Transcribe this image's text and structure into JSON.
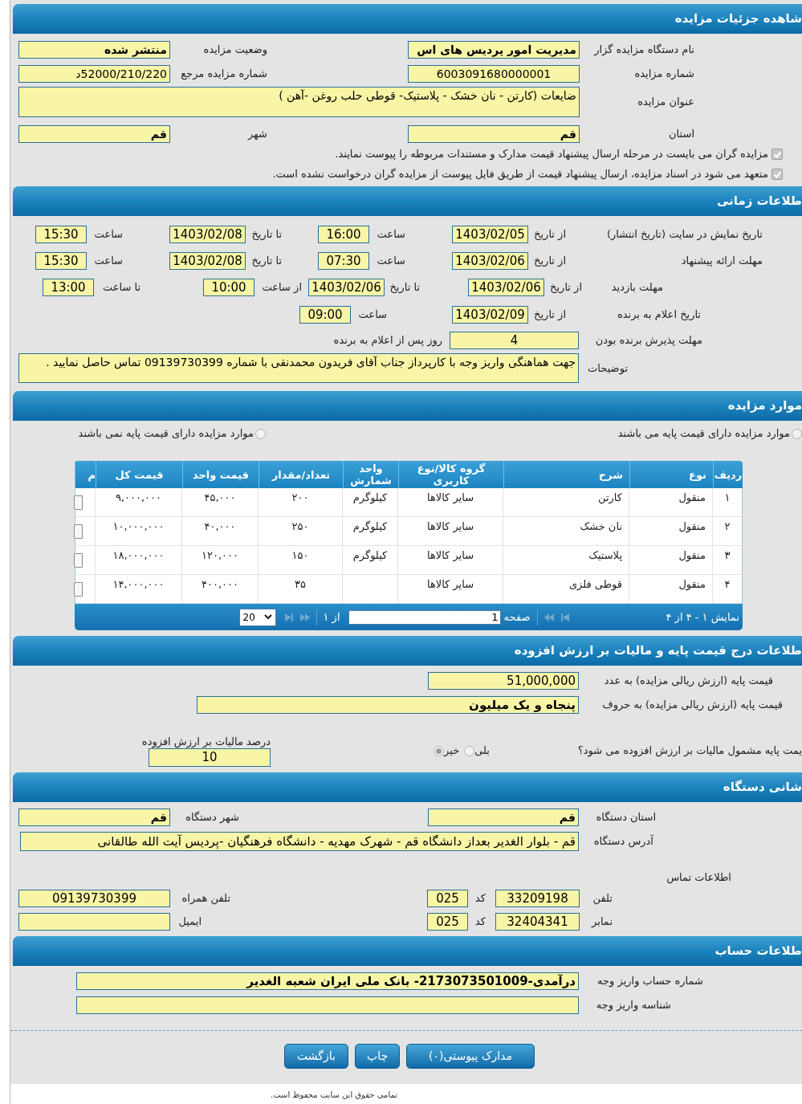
{
  "auction_details": {
    "title": "شاهده جزئیات مزایده",
    "organizer": {
      "label": "نام دستگاه مزایده گزار",
      "value": "مدیریت امور پردیس های اس"
    },
    "status": {
      "label": "وضعیت مزایده",
      "value": "منتشر شده"
    },
    "auction_number": {
      "label": "شماره مزایده",
      "value": "6003091680000001"
    },
    "reference_number": {
      "label": "شماره مزایده مرجع",
      "value": "52000/210/220د"
    },
    "subject": {
      "label": "عنوان مزایده",
      "value": "ضایعات (کارتن - نان خشک - پلاستیک- قوطی حلب روغن -آهن )"
    },
    "province": {
      "label": "استان",
      "value": "قم"
    },
    "city": {
      "label": "شهر",
      "value": "قم"
    },
    "checks": [
      {
        "label": "مزایده گران می بایست در مرحله ارسال پیشنهاد قیمت مدارک و مستندات مربوطه را پیوست نمایند.",
        "checked": true,
        "disabled": true
      },
      {
        "label": "متعهد می شود در اسناد مزایده، ارسال پیشنهاد قیمت از طریق فایل پیوست از مزایده گران درخواست نشده است.",
        "checked": true,
        "disabled": true
      }
    ]
  },
  "timing": {
    "title": "طلاعات زمانی",
    "publish": {
      "label": "تاریخ نمایش در سایت (تاریخ انتشار)",
      "parts": [
        {
          "label": "از تاریخ",
          "value": "1403/02/05"
        },
        {
          "label": "ساعت",
          "value": "16:00"
        },
        {
          "label": "تا تاریخ",
          "value": "1403/02/08"
        },
        {
          "label": "ساعت",
          "value": "15:30"
        }
      ]
    },
    "bid_deadline": {
      "label": "مهلت ارائه پیشنهاد",
      "parts": [
        {
          "label": "از تاریخ",
          "value": "1403/02/06"
        },
        {
          "label": "ساعت",
          "value": "07:30"
        },
        {
          "label": "تا تاریخ",
          "value": "1403/02/08"
        },
        {
          "label": "ساعت",
          "value": "15:30"
        }
      ]
    },
    "visit": {
      "label": "مهلت بازدید",
      "parts": [
        {
          "label": "از تاریخ",
          "value": "1403/02/06"
        },
        {
          "label": "تا تاریخ",
          "value": "1403/02/06"
        },
        {
          "label": "از ساعت",
          "value": "10:00"
        },
        {
          "label": "تا ساعت",
          "value": "13:00"
        }
      ]
    },
    "winner_announcement": {
      "label": "تاریخ اعلام به برنده",
      "parts": [
        {
          "label": "از تاریخ",
          "value": "1403/02/09"
        },
        {
          "label": "ساعت",
          "value": "09:00"
        }
      ]
    },
    "acceptance": {
      "label": "مهلت پذیرش برنده بودن",
      "value": "4",
      "suffix": "روز پس از اعلام به برنده"
    },
    "notes": {
      "label": "توضیحات",
      "value": "جهت هماهنگی واریز وجه با کارپرداز جناب آقای فریدون محمدنقی با شماره 09139730399 تماس حاصل نمایید ."
    }
  },
  "items": {
    "title": "موارد مزایده",
    "price_options": [
      {
        "label": "موارد مزایده دارای قیمت پایه می باشند",
        "selected": false
      },
      {
        "label": "موارد مزایده دارای قیمت پایه نمی باشند",
        "selected": false
      }
    ],
    "table": {
      "columns": [
        "ردیف",
        "نوع",
        "شرح",
        "گروه کالا/نوع کاربری",
        "واحد شمارش",
        "تعداد/مقدار",
        "قیمت واحد",
        "قیمت کل",
        "م"
      ],
      "rows": [
        {
          "cells": [
            "۱",
            "منقول",
            "کارتن",
            "سایر کالاها",
            "کیلوگرم",
            "۲۰۰",
            "۴۵,۰۰۰",
            "۹,۰۰۰,۰۰۰"
          ]
        },
        {
          "cells": [
            "۲",
            "منقول",
            "نان خشک",
            "سایر کالاها",
            "کیلوگرم",
            "۲۵۰",
            "۴۰,۰۰۰",
            "۱۰,۰۰۰,۰۰۰"
          ]
        },
        {
          "cells": [
            "۳",
            "منقول",
            "پلاستیک",
            "سایر کالاها",
            "کیلوگرم",
            "۱۵۰",
            "۱۲۰,۰۰۰",
            "۱۸,۰۰۰,۰۰۰"
          ]
        },
        {
          "cells": [
            "۴",
            "منقول",
            "قوطی فلزی",
            "سایر کالاها",
            "",
            "۳۵",
            "۴۰۰,۰۰۰",
            "۱۴,۰۰۰,۰۰۰"
          ]
        }
      ]
    },
    "pager": {
      "summary": "نمایش ۱ - ۴ از ۴",
      "page_label": "صفحه",
      "page": "1",
      "of_label": "از ۱",
      "page_size": "20"
    }
  },
  "pricing": {
    "title": "طلاعات درج قیمت پایه و مالیات بر ارزش افزوده",
    "base_price_number": {
      "label": "قیمت پایه (ارزش ریالی مزایده) به عدد",
      "value": "51,000,000"
    },
    "base_price_words": {
      "label": "قیمت پایه (ارزش ریالی مزایده) به حروف",
      "value": "پنجاه و یک میلیون"
    },
    "vat_question": {
      "label": "یمت پایه مشمول مالیات بر ارزش افزوده می شود؟",
      "options": [
        {
          "label": "بلی",
          "selected": false
        },
        {
          "label": "خیر",
          "selected": true
        }
      ]
    },
    "vat_percent": {
      "label": "درصد مالیات بر ارزش افزوده",
      "value": "10"
    }
  },
  "organization_address": {
    "title": "شانی دستگاه",
    "province": {
      "label": "استان دستگاه",
      "value": "قم"
    },
    "city": {
      "label": "شهر دستگاه",
      "value": "قم"
    },
    "address": {
      "label": "آدرس دستگاه",
      "value": "قم - بلوار الغدیر بعداز دانشگاه قم - شهرک مهدیه - دانشگاه فرهنگیان -پردیس آیت الله طالقانی"
    },
    "contact_title": "اطلاعات تماس",
    "phone": {
      "label": "تلفن",
      "value": "33209198",
      "code_label": "کد",
      "code": "025"
    },
    "mobile": {
      "label": "تلفن همراه",
      "value": "09139730399"
    },
    "fax": {
      "label": "نمابر",
      "value": "32404341",
      "code_label": "کد",
      "code": "025"
    },
    "email": {
      "label": "ایمیل"
    }
  },
  "account": {
    "title": "طلاعات حساب",
    "account_number": {
      "label": "شماره حساب واریز وجه",
      "value": "درآمدی-2173073501009- بانک ملی ایران شعبه الغدیر"
    },
    "payment_id": {
      "label": "شناسه واریز وجه"
    }
  },
  "buttons": [
    "مدارک پیوستی(۰)",
    "چاپ",
    "بازگشت"
  ],
  "footer": "تمامی حقوق این سایت محفوظ است."
}
